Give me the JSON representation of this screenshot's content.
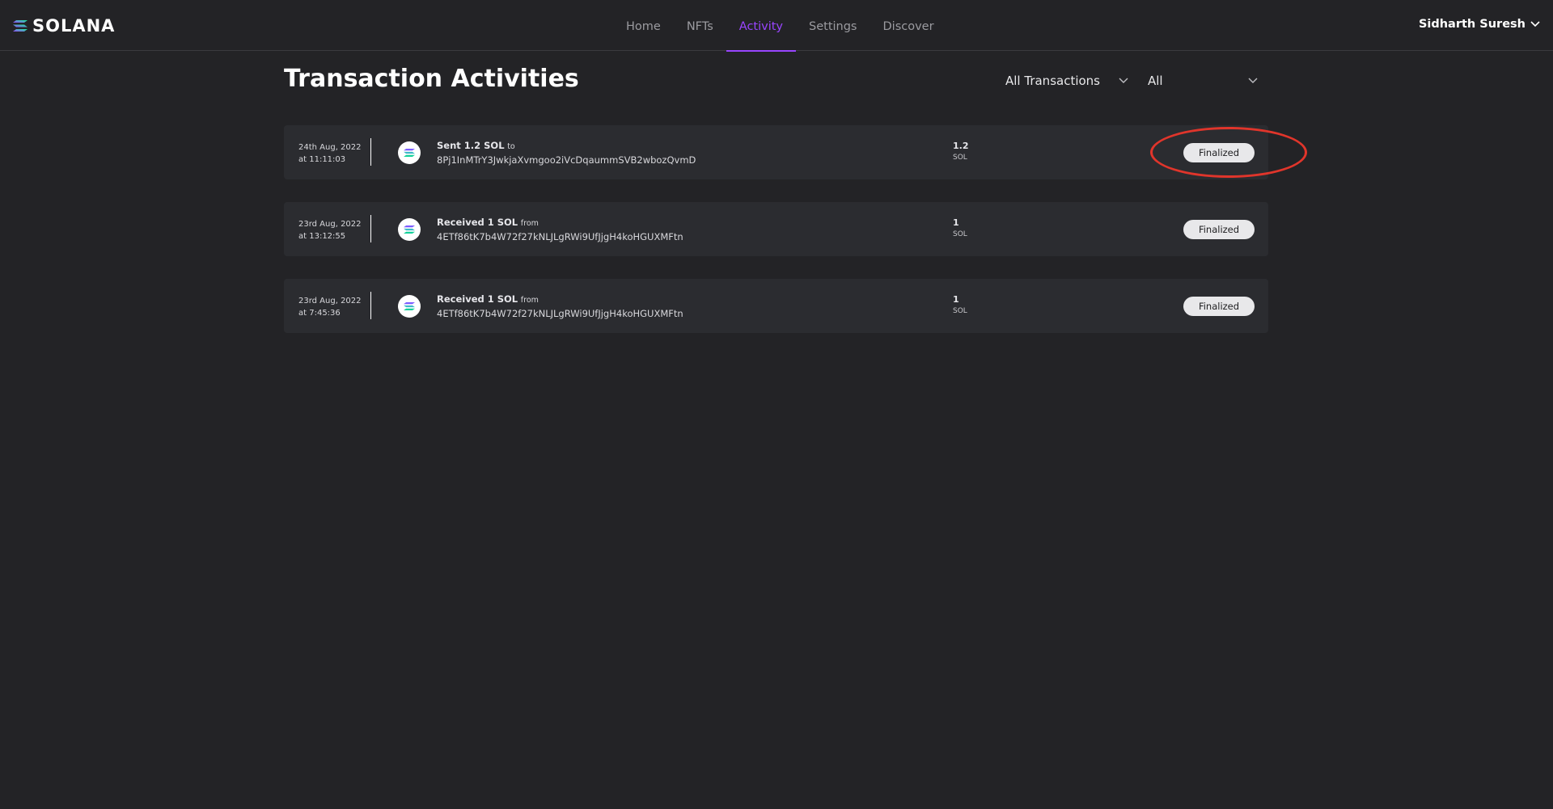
{
  "app": {
    "logo_text": "SOLANA",
    "accent_color": "#9945ff"
  },
  "nav": {
    "items": [
      {
        "label": "Home",
        "active": false
      },
      {
        "label": "NFTs",
        "active": false
      },
      {
        "label": "Activity",
        "active": true
      },
      {
        "label": "Settings",
        "active": false
      },
      {
        "label": "Discover",
        "active": false
      }
    ]
  },
  "user": {
    "name": "Sidharth Suresh",
    "icon": "chevron-down-icon"
  },
  "page": {
    "title": "Transaction Activities"
  },
  "filters": {
    "type_selected": "All Transactions",
    "status_selected": "All"
  },
  "transactions": [
    {
      "date": "24th Aug, 2022",
      "time": "at 11:11:03",
      "action": "Sent 1.2 SOL",
      "preposition": "to",
      "address": "8Pj1InMTrY3JwkjaXvmgoo2iVcDqaummSVB2wbozQvmD",
      "amount": "1.2",
      "unit": "SOL",
      "status": "Finalized"
    },
    {
      "date": "23rd Aug, 2022",
      "time": "at 13:12:55",
      "action": "Received 1 SOL",
      "preposition": "from",
      "address": "4ETf86tK7b4W72f27kNLJLgRWi9UfJjgH4koHGUXMFtn",
      "amount": "1",
      "unit": "SOL",
      "status": "Finalized"
    },
    {
      "date": "23rd Aug, 2022",
      "time": "at 7:45:36",
      "action": "Received 1 SOL",
      "preposition": "from",
      "address": "4ETf86tK7b4W72f27kNLJLgRWi9UfJjgH4koHGUXMFtn",
      "amount": "1",
      "unit": "SOL",
      "status": "Finalized"
    }
  ],
  "annotation": {
    "color": "#e0352b"
  }
}
